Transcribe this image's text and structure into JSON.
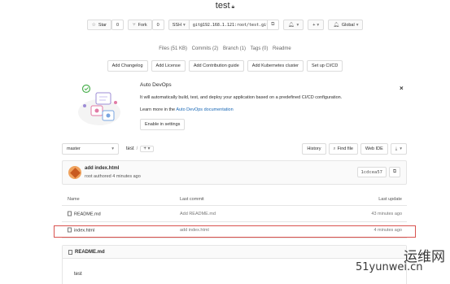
{
  "project": {
    "title": "test",
    "lock_icon": "lock-icon"
  },
  "header_buttons": {
    "star_label": "Star",
    "star_count": "0",
    "fork_label": "Fork",
    "fork_count": "0",
    "clone_protocol": "SSH",
    "clone_url": "git@192.168.1.121:root/test.git",
    "notif_label": "",
    "plus_label": "+",
    "visibility_label": "Global"
  },
  "stats": {
    "files": "Files (51 KB)",
    "commits": "Commits (2)",
    "branch": "Branch (1)",
    "tags": "Tags (0)",
    "readme": "Readme"
  },
  "quick_actions": [
    "Add Changelog",
    "Add License",
    "Add Contribution guide",
    "Add Kubernetes cluster",
    "Set up CI/CD"
  ],
  "autodevops": {
    "title": "Auto DevOps",
    "description": "It will automatically build, test, and deploy your application based on a predefined CI/CD configuration.",
    "learn_prefix": "Learn more in the ",
    "learn_link": "Auto DevOps documentation",
    "enable_button": "Enable in settings",
    "close": "×"
  },
  "tree": {
    "branch": "master",
    "path": "test",
    "separator": "/",
    "add": "+",
    "history": "History",
    "find_file": "Find file",
    "web_ide": "Web IDE"
  },
  "last_commit": {
    "message": "add index.html",
    "author_line": "root authored 4 minutes ago",
    "sha": "1cdcea57"
  },
  "files_table": {
    "headers": {
      "name": "Name",
      "last_commit": "Last commit",
      "last_update": "Last update"
    },
    "rows": [
      {
        "name": "README.md",
        "commit": "Add README.md",
        "updated": "43 minutes ago"
      },
      {
        "name": "index.html",
        "commit": "add index.html",
        "updated": "4 minutes ago"
      }
    ]
  },
  "readme": {
    "title": "README.md",
    "content": "test"
  },
  "watermark": {
    "line1": "运维网",
    "line2": "51yunwei.cn"
  }
}
